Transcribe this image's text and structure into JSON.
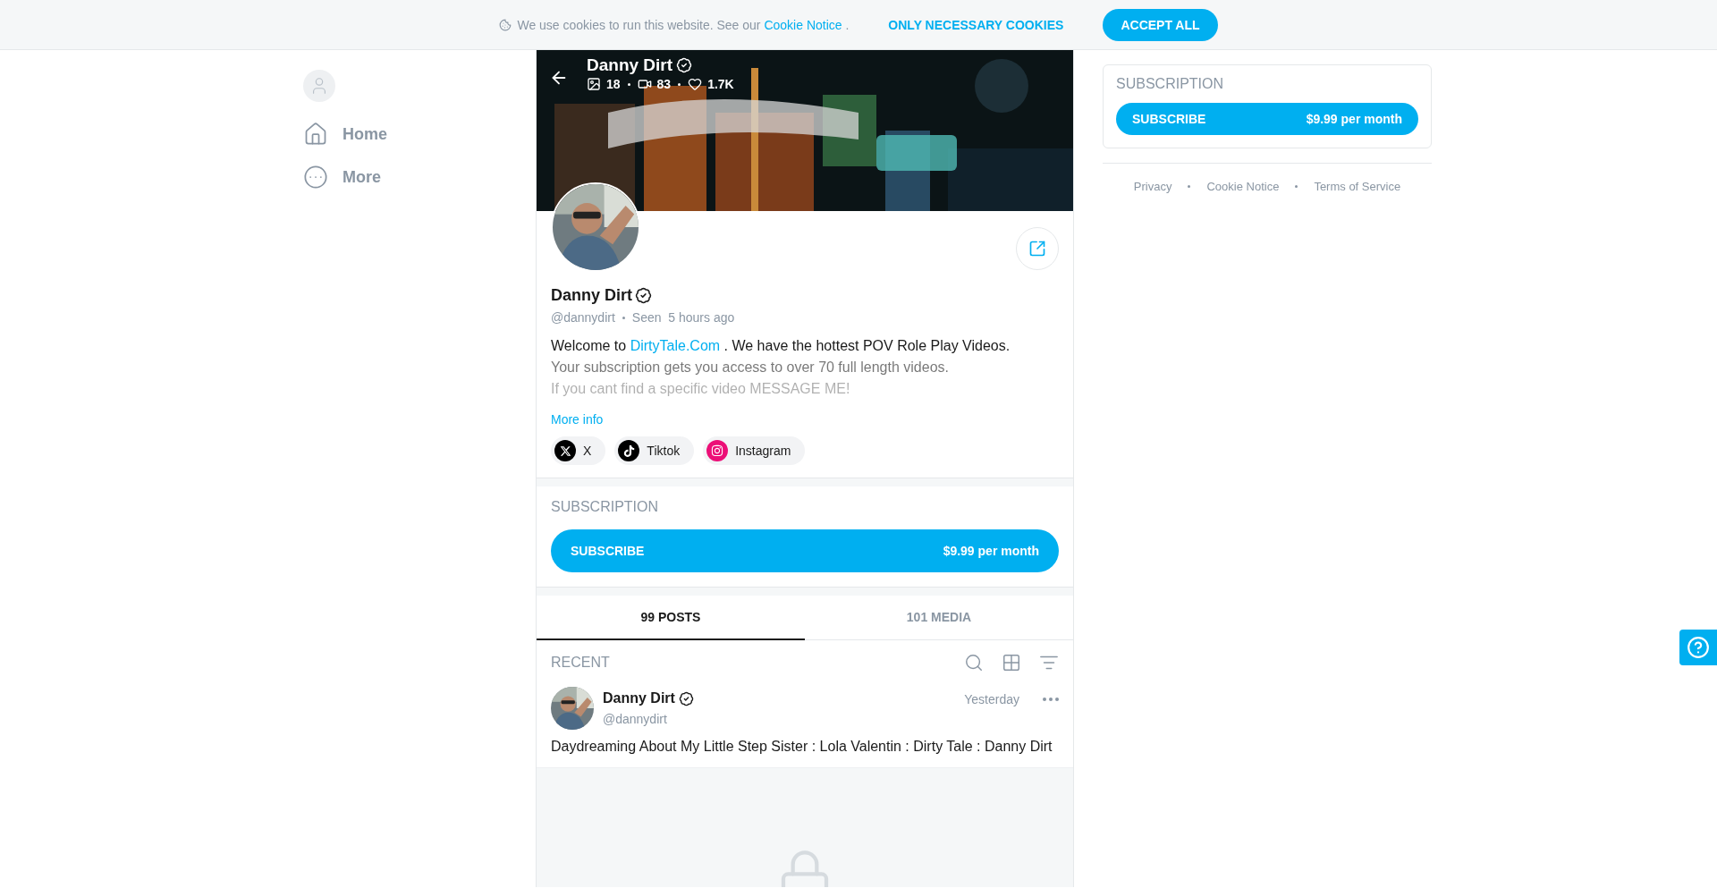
{
  "cookie_bar": {
    "text": "We use cookies to run this website. See our",
    "link": "Cookie Notice",
    "after": ".",
    "buttons": [
      {
        "label": "ONLY NECESSARY COOKIES",
        "kind": "text"
      },
      {
        "label": "ACCEPT ALL",
        "kind": "filled"
      }
    ]
  },
  "sidebar": {
    "items": [
      {
        "label": "Home",
        "kind": "home"
      },
      {
        "label": "More",
        "kind": "more"
      }
    ]
  },
  "profile": {
    "banner": {
      "kind": "picture",
      "name": "Danny Dirt",
      "verified": true,
      "stats": [
        {
          "kind": "photos",
          "value": "18"
        },
        {
          "kind": "videos",
          "value": "83"
        },
        {
          "kind": "likes",
          "value": "1.7K"
        }
      ]
    },
    "name": "Danny Dirt",
    "verified": true,
    "handle": "@dannydirt",
    "seen_label": "Seen",
    "seen": "5 hours ago",
    "bio_first": {
      "before": "Welcome to",
      "link": "DirtyTale.Com",
      "after": ". We have the hottest POV Role Play Videos."
    },
    "bio_lines": [
      {
        "text": "Your subscription gets you access to over 70 full length videos.",
        "kind": "muted"
      },
      {
        "text": "If you cant find a specific video MESSAGE ME!",
        "kind": "faint"
      }
    ],
    "more_info": "More info",
    "socials": [
      {
        "label": "X",
        "kind": "x"
      },
      {
        "label": "Tiktok",
        "kind": "tiktok"
      },
      {
        "label": "Instagram",
        "kind": "instagram"
      }
    ]
  },
  "subscription": {
    "title": "SUBSCRIPTION",
    "button": "SUBSCRIBE",
    "price": "$9.99 per month"
  },
  "tabs": [
    {
      "label": "99 POSTS",
      "selected": true
    },
    {
      "label": "101 MEDIA",
      "selected": false
    }
  ],
  "recent": {
    "title": "RECENT"
  },
  "post": {
    "author": "Danny Dirt",
    "verified": true,
    "handle": "@dannydirt",
    "time": "Yesterday",
    "text": "Daydreaming About My Little Step Sister : Lola Valentin : Dirty Tale : Danny Dirt",
    "locked": true
  },
  "side_subscription": {
    "title": "SUBSCRIPTION",
    "button": "SUBSCRIBE",
    "price": "$9.99 per month"
  },
  "footer_links": [
    "Privacy",
    "Cookie Notice",
    "Terms of Service"
  ]
}
